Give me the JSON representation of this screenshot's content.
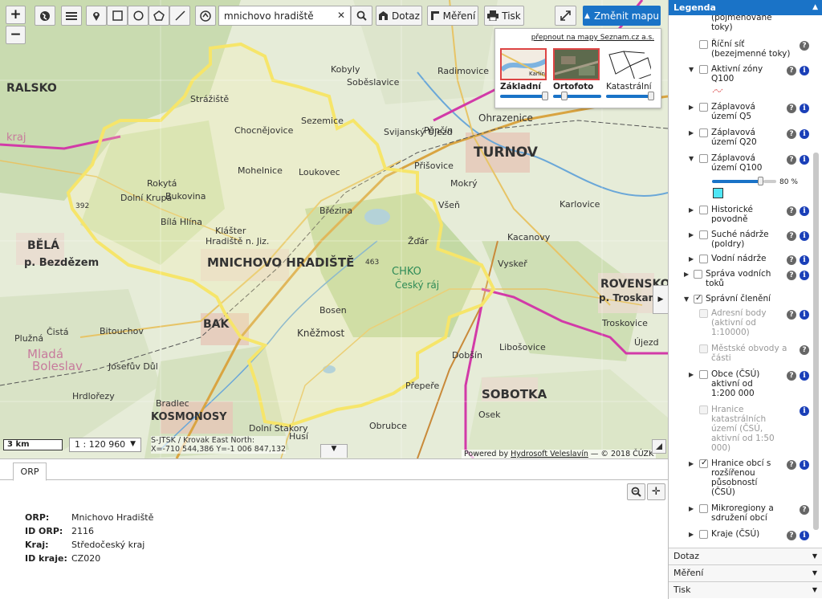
{
  "toolbar": {
    "zoom_in": "+",
    "zoom_out": "−",
    "search_value": "mnichovo hradiště",
    "search_clear": "✕",
    "dotaz_label": "Dotaz",
    "mereni_label": "Měření",
    "tisk_label": "Tisk",
    "change_map_label": "Změnit mapu",
    "change_map_arrow": "▲"
  },
  "basemaps": {
    "switch_link": "přepnout na mapy Seznam.cz a.s.",
    "items": [
      {
        "label": "Základní",
        "opacity": 1.0,
        "thumb_text": "Karlín"
      },
      {
        "label": "Ortofoto",
        "opacity": 0.2
      },
      {
        "label": "Katastrální",
        "opacity": 1.0
      }
    ]
  },
  "map_labels": {
    "ralsko": "RALSKO",
    "turnov": "TURNOV",
    "mnichovo": "MNICHOVO HRADIŠTĚ",
    "bela": "BĚLÁ",
    "bezdezem": "p. Bezdězem",
    "kosmonosy": "KOSMONOSY",
    "sobotka": "SOBOTKA",
    "rovensko": "ROVENSKO",
    "troskami": "p. Troskami",
    "chko": "CHKO",
    "cesky_raj": "Český ráj",
    "mlada": "Mladá",
    "boleslav": "Boleslav",
    "kraj": "kraj",
    "bakov": "BAK",
    "sezemice": "Sezemice",
    "chocnejovice": "Chocnějovice",
    "mohelnice": "Mohelnice",
    "loukovec": "Loukovec",
    "rokyta": "Rokytá",
    "bukovina": "Bukovina",
    "bila_hlina": "Bílá Hlína",
    "klaster": "Klášter",
    "hradiste_nj": "Hradiště n. Jiz.",
    "dolni_krupa": "Dolní Krupá",
    "brezina": "Březina",
    "zdar": "Žďár",
    "bosen": "Bosen",
    "knezmost": "Kněžmost",
    "dolni_stakory": "Dolní Stakory",
    "hrdlorezy": "Hrdlořezy",
    "josefuv_dul": "Josefův Důl",
    "bradlec": "Bradlec",
    "plužna": "Plužná",
    "cista": "Čistá",
    "bitouchov": "Bitouchov",
    "kacanovy": "Kacanovy",
    "vsen": "Všeň",
    "prisovice": "Přišovice",
    "mokry": "Mokrý",
    "libosovice": "Libošovice",
    "dobsin": "Dobšín",
    "ohrazenice": "Ohrazenice",
    "penčin": "Pěnčín",
    "svijansky": "Svijanský Újezd",
    "sobeslavice": "Soběslavice",
    "kobyly": "Kobyly",
    "radimovice": "Radimovice",
    "strazek": "Strážiště",
    "karlovice": "Karlovice",
    "vyskerr": "Vyskeř",
    "troskovice": "Troskovice",
    "ujezd": "Újezd",
    "husi": "Husí",
    "obruce": "Obrubce",
    "prepere": "Přepeře",
    "oseck": "Osek",
    "num392": "392",
    "num463": "463"
  },
  "map_footer": {
    "scale_bar": "3 km",
    "scale_value": "1 : 120 960",
    "scale_arrow": "▼",
    "crs": "S-JTSK / Krovak East North:",
    "coords": "X=-710 544,386 Y=-1 006 847,132",
    "attribution_prefix": "Powered by",
    "attribution_link": "Hydrosoft Veleslavín",
    "attribution_suffix": "— © 2018 ČÚZK"
  },
  "bottom_panel": {
    "tab_label": "ORP",
    "attributes": [
      {
        "key": "ORP:",
        "value": "Mnichovo Hradiště"
      },
      {
        "key": "ID ORP:",
        "value": "2116"
      },
      {
        "key": "Kraj:",
        "value": "Středočeský kraj"
      },
      {
        "key": "ID kraje:",
        "value": "CZ020"
      }
    ]
  },
  "legend": {
    "title": "Legenda",
    "items": [
      {
        "label1": "(pojmenované",
        "label2": "toky)"
      },
      {
        "label1": "Říční síť",
        "label2": "(bezejmenné toky)"
      },
      {
        "label1": "Aktivní zóny",
        "label2": "Q100"
      },
      {
        "label1": "Záplavová",
        "label2": "území Q5"
      },
      {
        "label1": "Záplavová",
        "label2": "území Q20"
      },
      {
        "label1": "Záplavová",
        "label2": "území Q100"
      },
      {
        "label1": "Historické",
        "label2": "povodně"
      },
      {
        "label1": "Suché nádrže",
        "label2": "(poldry)"
      },
      {
        "label1": "Vodní nádrže"
      },
      {
        "label1": "Správa vodních",
        "label2": "toků"
      },
      {
        "label1": "Správní členění"
      },
      {
        "label1": "Adresní body",
        "label2": "(aktivní od",
        "label3": "1:10000)"
      },
      {
        "label1": "Městské obvody a",
        "label2": "části"
      },
      {
        "label1": "Obce (ČSÚ)",
        "label2": "aktivní od",
        "label3": "1:200 000"
      },
      {
        "label1": "Hranice",
        "label2": "katastrálních",
        "label3": "území (ČSÚ,",
        "label4": "aktivní od 1:50",
        "label5": "000)"
      },
      {
        "label1": "Hranice obcí s",
        "label2": "rozšířenou",
        "label3": "působností",
        "label4": "(ČSÚ)"
      },
      {
        "label1": "Mikroregiony a",
        "label2": "sdružení obcí"
      },
      {
        "label1": "Kraje (ČSÚ)"
      }
    ],
    "opacity_value": "80 %",
    "opacity_fraction": 0.8,
    "accordions": [
      {
        "label": "Dotaz"
      },
      {
        "label": "Měření"
      },
      {
        "label": "Tisk"
      }
    ]
  },
  "glyphs": {
    "q": "?",
    "i": "i",
    "tri_down": "▼",
    "tri_right": "▶",
    "tri_left": "◀",
    "move": "✛"
  }
}
